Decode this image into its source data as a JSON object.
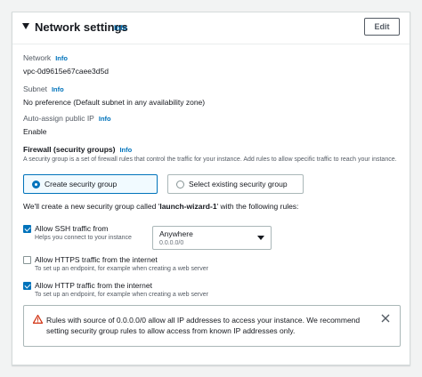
{
  "section": {
    "title": "Network settings",
    "info": "Info",
    "edit_label": "Edit"
  },
  "network": {
    "label": "Network",
    "info": "Info",
    "value": "vpc-0d9615e67caee3d5d"
  },
  "subnet": {
    "label": "Subnet",
    "info": "Info",
    "value": "No preference (Default subnet in any availability zone)"
  },
  "public_ip": {
    "label": "Auto-assign public IP",
    "info": "Info",
    "value": "Enable"
  },
  "firewall": {
    "title": "Firewall (security groups)",
    "info": "Info",
    "description": "A security group is a set of firewall rules that control the traffic for your instance. Add rules to allow specific traffic to reach your instance.",
    "options": [
      {
        "label": "Create security group",
        "selected": true
      },
      {
        "label": "Select existing security group",
        "selected": false
      }
    ],
    "sentence_prefix": "We'll create a new security group called '",
    "group_name": "launch-wizard-1",
    "sentence_suffix": "' with the following rules:"
  },
  "rules": [
    {
      "label": "Allow SSH traffic from",
      "description": "Helps you connect to your instance",
      "checked": true
    },
    {
      "label": "Allow HTTPS traffic from the internet",
      "description": "To set up an endpoint, for example when creating a web server",
      "checked": false
    },
    {
      "label": "Allow HTTP traffic from the internet",
      "description": "To set up an endpoint, for example when creating a web server",
      "checked": true
    }
  ],
  "ssh_source": {
    "value": "Anywhere",
    "sub": "0.0.0.0/0"
  },
  "alert": {
    "text": "Rules with source of 0.0.0.0/0 allow all IP addresses to access your instance. We recommend setting security group rules to allow access from known IP addresses only."
  },
  "colors": {
    "accent": "#0073bb",
    "warning": "#d13212"
  },
  "icons": {
    "caret": "caret-down-icon",
    "alert": "warning-icon",
    "close": "close-icon"
  }
}
